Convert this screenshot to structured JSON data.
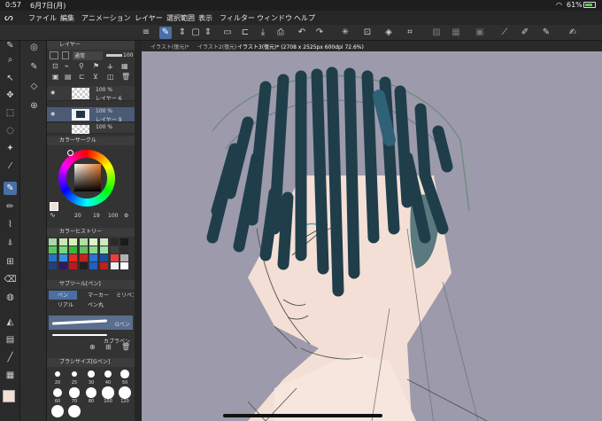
{
  "status": {
    "time": "0:57",
    "date": "6月7日(月)",
    "battery": "61%"
  },
  "menu": [
    "ファイル",
    "編集",
    "アニメーション",
    "レイヤー",
    "選択範囲",
    "表示",
    "フィルター",
    "ウィンドウ",
    "ヘルプ"
  ],
  "layer_panel": {
    "title": "レイヤー",
    "blend": "通常",
    "opacity": "100",
    "layers": [
      {
        "opacity": "100 %",
        "name": "レイヤー 6"
      },
      {
        "opacity": "100 %",
        "name": "レイヤー 9"
      },
      {
        "opacity": "100 %",
        "name": ""
      }
    ]
  },
  "color_circle": {
    "title": "カラーサークル",
    "h": "20",
    "s": "19",
    "v": "100"
  },
  "color_history": {
    "title": "カラーヒストリー",
    "colors": [
      "#a8d8a8",
      "#c8e8b0",
      "#d8f0b8",
      "#b0e0a0",
      "#e0f0c8",
      "#d0e8c0",
      "#2a2a2a",
      "#1a1a1a",
      "#58c858",
      "#78d878",
      "#38b838",
      "#60c060",
      "#88d888",
      "#a0e0a0",
      "#404040",
      "#303030",
      "#2870c8",
      "#3890e0",
      "#e82828",
      "#c82020",
      "#3070d0",
      "#1850a0",
      "#e84040",
      "#b0b0b0",
      "#204080",
      "#301860",
      "#c01818",
      "#202020",
      "#2060c0",
      "#c02020",
      "#f0f0f0",
      "#ffffff"
    ]
  },
  "subtool": {
    "title": "サブツール[ペン]",
    "items": [
      {
        "label": "ペン"
      },
      {
        "label": "マーカー"
      },
      {
        "label": "ミリペン"
      },
      {
        "label": "リアル"
      },
      {
        "label": "ペン丸"
      }
    ],
    "brushes": [
      {
        "label": "Gペン"
      },
      {
        "label": "カブラペン"
      }
    ]
  },
  "brush_size": {
    "title": "ブラシサイズ[Gペン]",
    "sizes": [
      "20",
      "25",
      "30",
      "40",
      "50",
      "60",
      "70",
      "80",
      "100",
      "120"
    ]
  },
  "tabs": [
    {
      "label": "イラスト(復元)*"
    },
    {
      "label": "イラスト2(復元)"
    },
    {
      "label": "イラスト3(復元)* (2708 x 2525px 600dpi 72.6%)"
    }
  ],
  "colors": {
    "accent": "#4a6fa5",
    "canvas_bg": "#9c9aab",
    "hair": "#1f3e4a",
    "skin": "#f4dfd6"
  }
}
